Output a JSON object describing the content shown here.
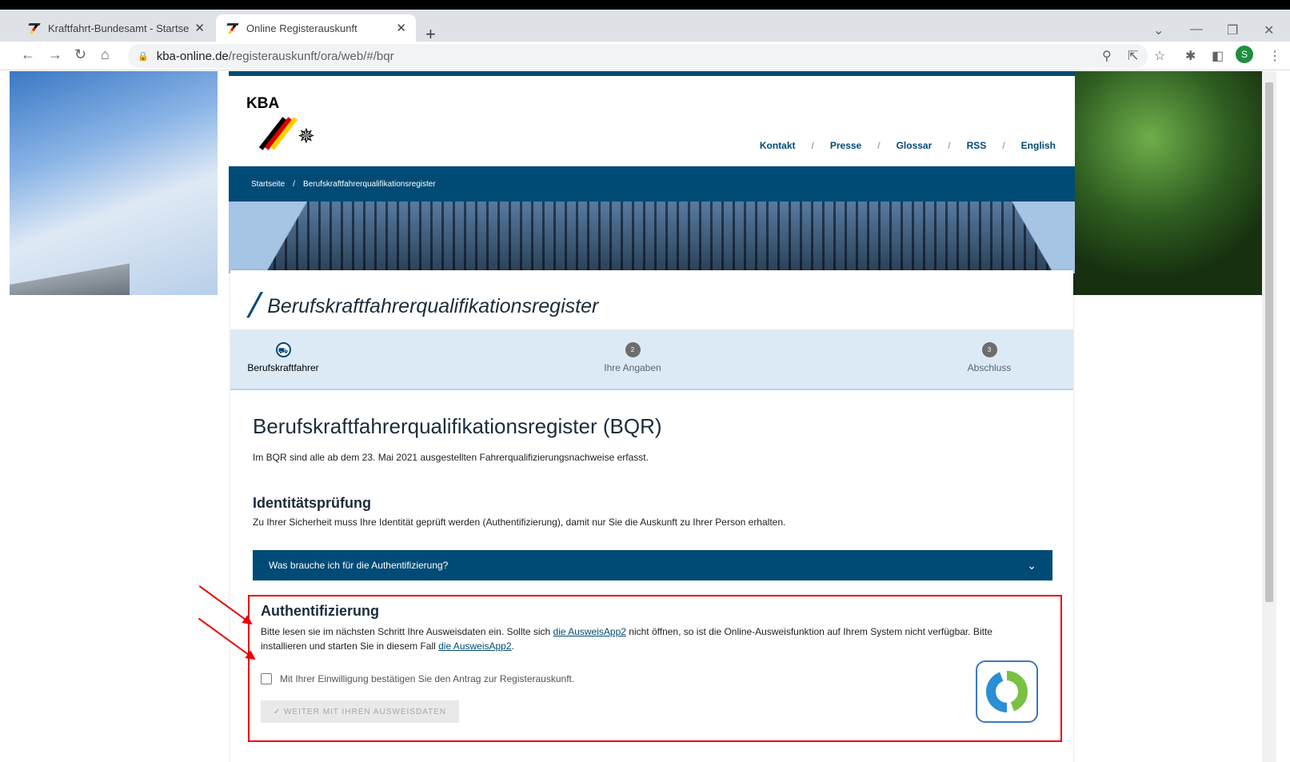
{
  "browser": {
    "tabs": [
      {
        "title": "Kraftfahrt-Bundesamt - Startseite",
        "close": "✕"
      },
      {
        "title": "Online Registerauskunft",
        "close": "✕"
      }
    ],
    "new_tab": "+",
    "url_domain": "kba-online.de",
    "url_path": "/registerauskunft/ora/web/#/bqr",
    "profile_initial": "S"
  },
  "header": {
    "logo_text": "KBA",
    "nav": [
      "Kontakt",
      "Presse",
      "Glossar",
      "RSS",
      "English"
    ],
    "nav_separator": "/"
  },
  "breadcrumb": {
    "home": "Startseite",
    "separator": "/",
    "current": "Berufskraftfahrerqualifikationsregister"
  },
  "card": {
    "title": "Berufskraftfahrerqualifikationsregister"
  },
  "stepper": {
    "steps": [
      {
        "num": "",
        "label": "Berufskraftfahrer",
        "active": true
      },
      {
        "num": "2",
        "label": "Ihre Angaben",
        "active": false
      },
      {
        "num": "3",
        "label": "Abschluss",
        "active": false
      }
    ]
  },
  "content": {
    "h1": "Berufskraftfahrerqualifikationsregister (BQR)",
    "lead": "Im BQR sind alle ab dem 23. Mai 2021 ausgestellten Fahrerqualifizierungsnachweise erfasst.",
    "h2": "Identitätsprüfung",
    "desc": "Zu Ihrer Sicherheit muss Ihre Identität geprüft werden (Authentifizierung), damit nur Sie die Auskunft zu Ihrer Person erhalten.",
    "accordion_label": "Was brauche ich für die Authentifizierung?"
  },
  "auth": {
    "title": "Authentifizierung",
    "text_1": "Bitte lesen sie im nächsten Schritt Ihre Ausweisdaten ein. Sollte sich ",
    "link_1": "die AusweisApp2",
    "text_2": " nicht öffnen, so ist die Online-Ausweisfunktion auf Ihrem System nicht verfügbar. Bitte installieren und starten Sie in diesem Fall ",
    "link_2": "die AusweisApp2",
    "text_3": ".",
    "checkbox_label": "Mit Ihrer Einwilligung bestätigen Sie den Antrag zur Registerauskunft.",
    "button_label": "✓ WEITER MIT IHREN AUSWEISDATEN"
  },
  "colors": {
    "primary": "#004b76",
    "highlight": "#e00000",
    "stepper_bg": "#dceaf6"
  }
}
